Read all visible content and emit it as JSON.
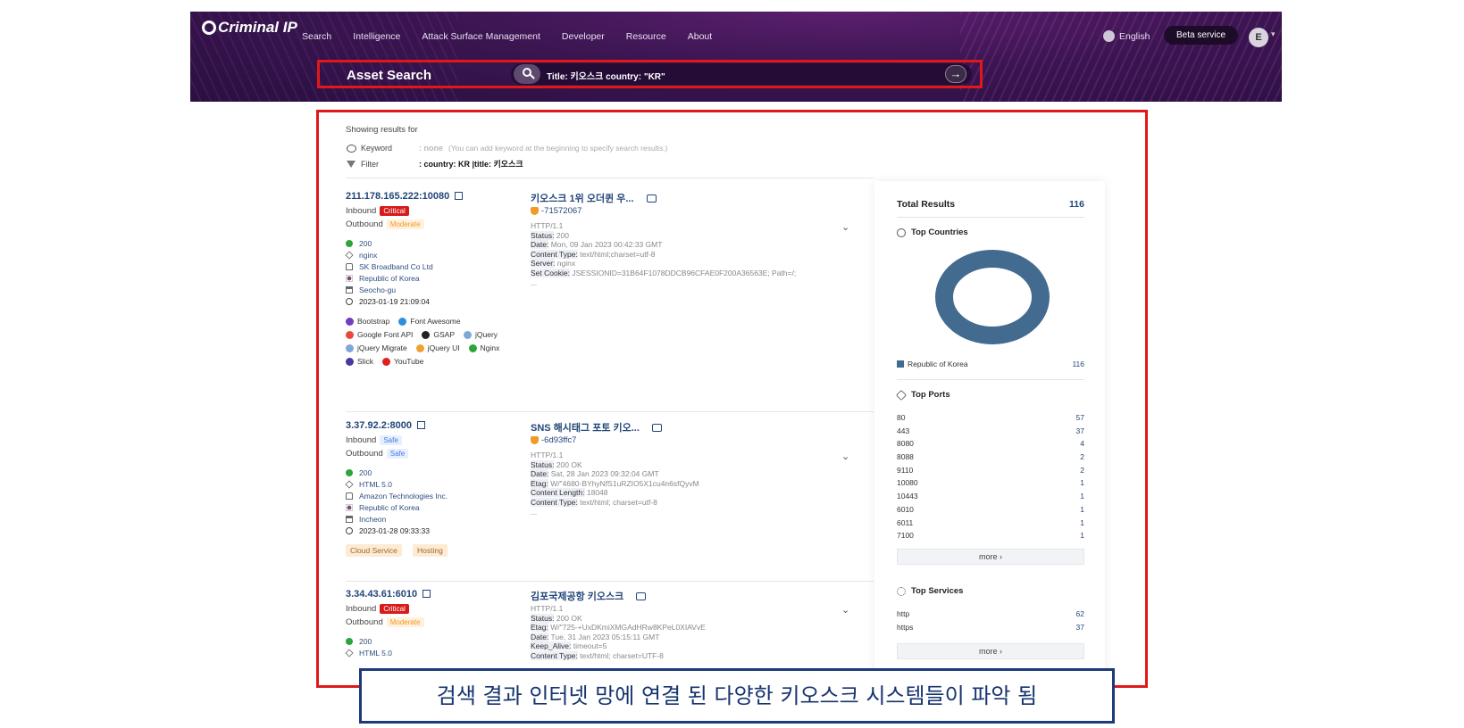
{
  "header": {
    "logo": "Criminal IP",
    "nav": [
      "Search",
      "Intelligence",
      "Attack Surface Management",
      "Developer",
      "Resource",
      "About"
    ],
    "language": "English",
    "beta": "Beta service",
    "avatar": "E",
    "search_title": "Asset Search",
    "search_query": "Title: 키오스크 country: \"KR\""
  },
  "results_header": {
    "showing": "Showing results for",
    "keyword_label": "Keyword",
    "keyword_value": ": none",
    "keyword_hint": "(You can add keyword at the beginning to specify search results.)",
    "filter_label": "Filter",
    "filter_value": ": country: KR |title: 키오스크"
  },
  "results": [
    {
      "ip": "211.178.165.222:10080",
      "inbound": "Inbound",
      "inbound_badge": "Critical",
      "outbound": "Outbound",
      "outbound_badge": "Moderate",
      "status": "200",
      "server": "nginx",
      "org": "SK Broadband Co Ltd",
      "country": "Republic of Korea",
      "city": "Seocho-gu",
      "date": "2023-01-19 21:09:04",
      "tech": [
        [
          "Bootstrap",
          "Font Awesome"
        ],
        [
          "Google Font API",
          "GSAP",
          "jQuery"
        ],
        [
          "jQuery Migrate",
          "jQuery UI",
          "Nginx"
        ],
        [
          "Slick",
          "YouTube"
        ]
      ],
      "title": "키오스크 1위 오더퀸 우...",
      "hash": "-71572067",
      "http": [
        {
          "k": "",
          "v": "HTTP/1.1"
        },
        {
          "k": "Status:",
          "v": " 200"
        },
        {
          "k": "Date:",
          "v": " Mon, 09 Jan 2023 00:42:33 GMT"
        },
        {
          "k": "Content Type:",
          "v": " text/html;charset=utf-8"
        },
        {
          "k": "Server:",
          "v": " nginx"
        },
        {
          "k": "Set Cookie:",
          "v": " JSESSIONID=31B64F1078DDCB96CFAE0F200A36563E; Path=/;"
        },
        {
          "k": "",
          "v": "..."
        }
      ]
    },
    {
      "ip": "3.37.92.2:8000",
      "inbound": "Inbound",
      "inbound_badge": "Safe",
      "outbound": "Outbound",
      "outbound_badge": "Safe",
      "status": "200",
      "server": "HTML 5.0",
      "org": "Amazon Technologies Inc.",
      "country": "Republic of Korea",
      "city": "Incheon",
      "date": "2023-01-28 09:33:33",
      "tags": [
        "Cloud Service",
        "Hosting"
      ],
      "title": "SNS 해시태그 포토 키오...",
      "hash": "-6d93ffc7",
      "http": [
        {
          "k": "",
          "v": "HTTP/1.1"
        },
        {
          "k": "Status:",
          "v": " 200 OK"
        },
        {
          "k": "Date:",
          "v": " Sat, 28 Jan 2023 09:32:04 GMT"
        },
        {
          "k": "Etag:",
          "v": " W/\"4680-BYhyNfS1uRZIO5X1cu4n6sfQyvM"
        },
        {
          "k": "Content Length:",
          "v": " 18048"
        },
        {
          "k": "Content Type:",
          "v": " text/html; charset=utf-8"
        },
        {
          "k": "",
          "v": "..."
        }
      ]
    },
    {
      "ip": "3.34.43.61:6010",
      "inbound": "Inbound",
      "inbound_badge": "Critical",
      "outbound": "Outbound",
      "outbound_badge": "Moderate",
      "status": "200",
      "server": "HTML 5.0",
      "title": "김포국제공항 키오스크",
      "http": [
        {
          "k": "",
          "v": "HTTP/1.1"
        },
        {
          "k": "Status:",
          "v": " 200 OK"
        },
        {
          "k": "Etag:",
          "v": " W/\"725-+UxDKmiXMGAdHRw8KPeL0XIAVvE"
        },
        {
          "k": "Date:",
          "v": " Tue, 31 Jan 2023 05:15:11 GMT"
        },
        {
          "k": "Keep_Alive:",
          "v": " timeout=5"
        },
        {
          "k": "Content Type:",
          "v": " text/html; charset=UTF-8"
        }
      ]
    }
  ],
  "panel": {
    "total_label": "Total Results",
    "total": "116",
    "countries_title": "Top Countries",
    "countries": [
      {
        "name": "Republic of Korea",
        "count": "116"
      }
    ],
    "donut_color": "#426b8f",
    "ports_title": "Top Ports",
    "ports": [
      {
        "port": "80",
        "count": "57"
      },
      {
        "port": "443",
        "count": "37"
      },
      {
        "port": "8080",
        "count": "4"
      },
      {
        "port": "8088",
        "count": "2"
      },
      {
        "port": "9110",
        "count": "2"
      },
      {
        "port": "10080",
        "count": "1"
      },
      {
        "port": "10443",
        "count": "1"
      },
      {
        "port": "6010",
        "count": "1"
      },
      {
        "port": "6011",
        "count": "1"
      },
      {
        "port": "7100",
        "count": "1"
      }
    ],
    "more": "more ›",
    "services_title": "Top Services",
    "services": [
      {
        "name": "http",
        "count": "62"
      },
      {
        "name": "https",
        "count": "37"
      }
    ]
  },
  "caption": "검색 결과 인터넷 망에 연결 된 다양한 키오스크 시스템들이 파악 됨"
}
